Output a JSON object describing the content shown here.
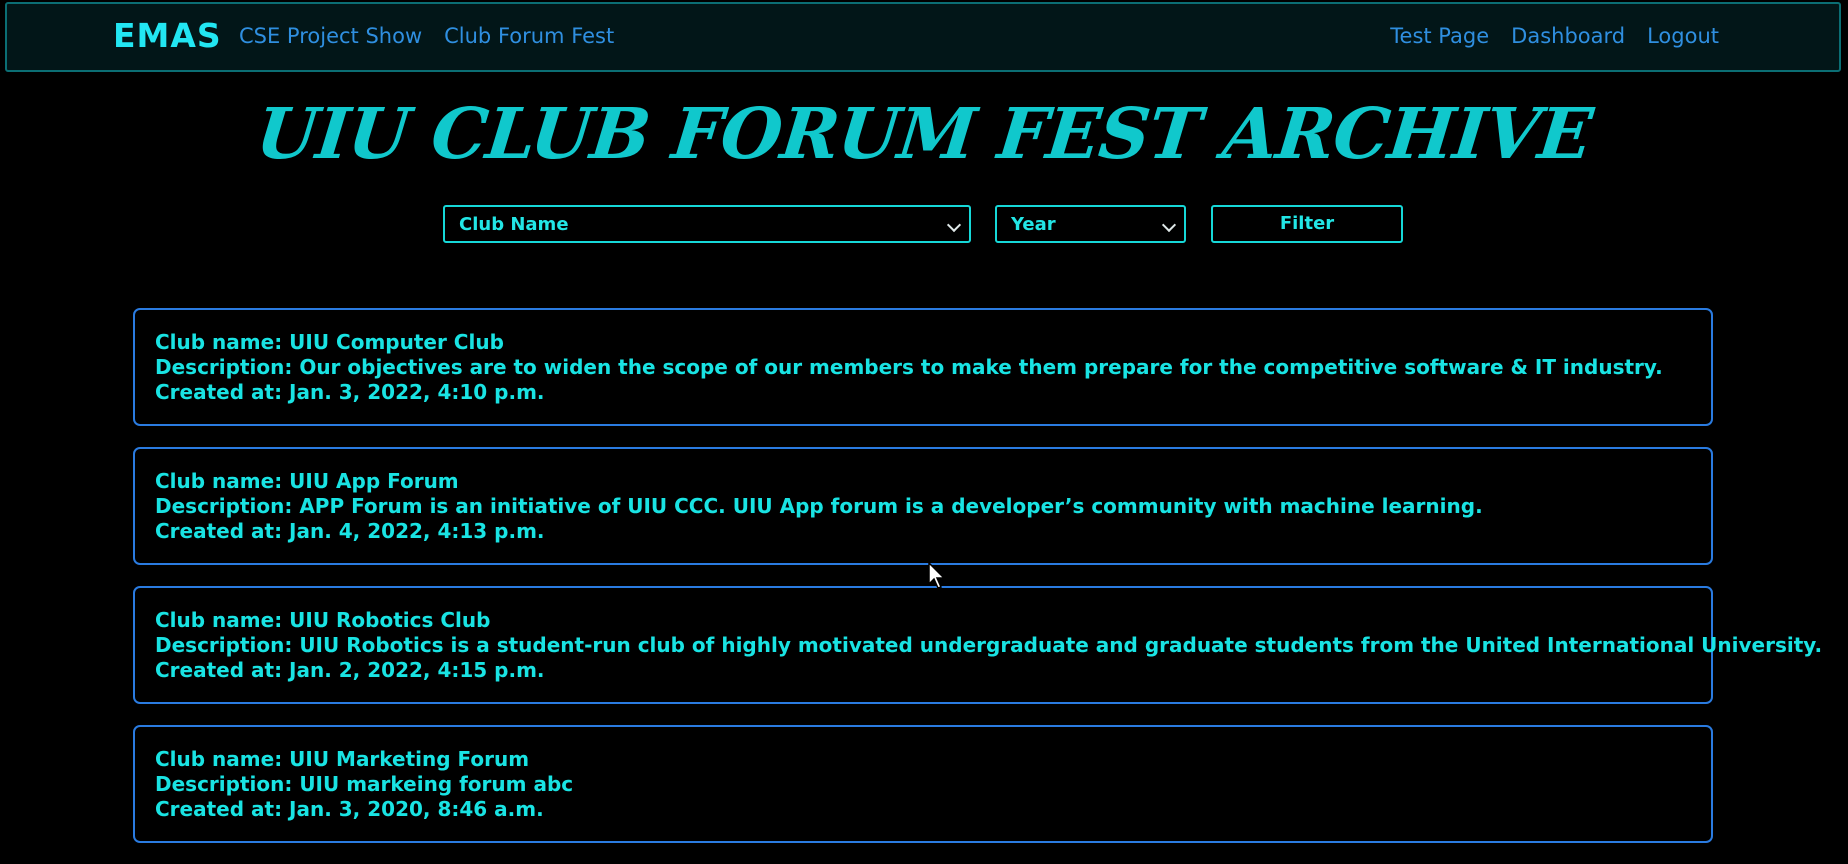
{
  "navbar": {
    "brand": "EMAS",
    "left_links": [
      "CSE Project Show",
      "Club Forum Fest"
    ],
    "right_links": [
      "Test Page",
      "Dashboard",
      "Logout"
    ]
  },
  "page": {
    "title": "UIU CLUB FORUM FEST ARCHIVE"
  },
  "filters": {
    "club_select": "Club Name",
    "year_select": "Year",
    "filter_button": "Filter"
  },
  "clubs": [
    {
      "name": "Club name: UIU Computer Club",
      "description": "Description: Our objectives are to widen the scope of our members to make them prepare for the competitive software & IT industry.",
      "created": "Created at: Jan. 3, 2022, 4:10 p.m."
    },
    {
      "name": "Club name: UIU App Forum",
      "description": "Description: APP Forum is an initiative of UIU CCC. UIU App forum is a developer’s community with machine learning.",
      "created": "Created at: Jan. 4, 2022, 4:13 p.m."
    },
    {
      "name": "Club name: UIU Robotics Club",
      "description": "Description: UIU Robotics is a student-run club of highly motivated undergraduate and graduate students from the United International University.",
      "created": "Created at: Jan. 2, 2022, 4:15 p.m."
    },
    {
      "name": "Club name: UIU Marketing Forum",
      "description": "Description: UIU markeing forum abc",
      "created": "Created at: Jan. 3, 2020, 8:46 a.m."
    }
  ],
  "colors": {
    "background": "#000000",
    "accent_cyan": "#10c8cc",
    "link_blue": "#2f8fe0",
    "card_border": "#2a7be0"
  }
}
